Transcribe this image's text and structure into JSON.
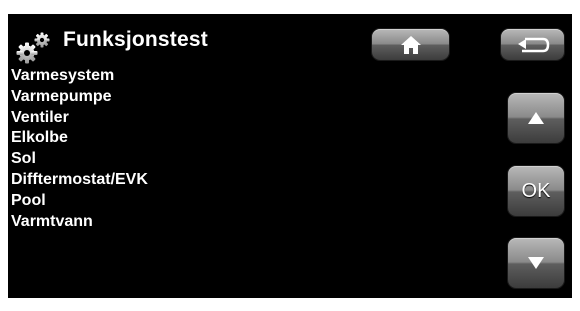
{
  "header": {
    "title": "Funksjonstest",
    "title_icon": "gears-icon"
  },
  "menu": {
    "items": [
      {
        "label": "Varmesystem"
      },
      {
        "label": "Varmepumpe"
      },
      {
        "label": "Ventiler"
      },
      {
        "label": "Elkolbe"
      },
      {
        "label": "Sol"
      },
      {
        "label": "Difftermostat/EVK"
      },
      {
        "label": "Pool"
      },
      {
        "label": "Varmtvann"
      }
    ]
  },
  "buttons": {
    "home_icon": "home-icon",
    "back_icon": "back-arrow-icon",
    "up_icon": "arrow-up-icon",
    "ok_label": "OK",
    "down_icon": "arrow-down-icon"
  },
  "colors": {
    "background": "#000000",
    "text": "#ffffff",
    "button_light": "#b9b9b9",
    "button_dark": "#3c3c3c"
  }
}
